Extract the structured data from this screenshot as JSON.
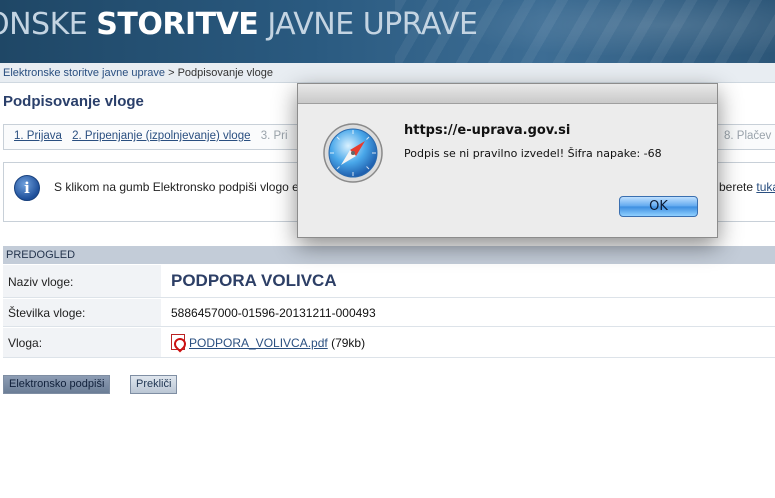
{
  "header": {
    "title_light_prefix": "ONSKE ",
    "title_bold": "STORITVE",
    "title_light_suffix": " JAVNE UPRAVE"
  },
  "breadcrumb": {
    "root": "Elektronske storitve javne uprave",
    "separator": " > ",
    "current": "Podpisovanje vloge"
  },
  "page_title": "Podpisovanje vloge",
  "steps": {
    "items": [
      "1. Prijava",
      "2. Pripenjanje (izpolnjevanje) vloge",
      "3. Pri"
    ],
    "right_item": "8. Plačev"
  },
  "info": {
    "text": "S klikom na gumb Elektronsko podpiši vlogo e",
    "text_right_prefix": "berete ",
    "text_right_link": "tuka"
  },
  "preview": {
    "section_title": "PREDOGLED",
    "rows": [
      {
        "label": "Naziv vloge:",
        "value": "PODPORA VOLIVCA"
      },
      {
        "label": "Številka vloge:",
        "value": "5886457000-01596-20131211-000493"
      },
      {
        "label": "Vloga:",
        "file_name": "PODPORA_VOLIVCA.pdf",
        "file_size": " (79kb)"
      }
    ]
  },
  "buttons": {
    "sign": "Elektronsko podpiši",
    "cancel": "Prekliči"
  },
  "dialog": {
    "host": "https://e-uprava.gov.si",
    "message": "Podpis se ni pravilno izvedel! Šifra napake:  -68",
    "ok_label": "OK"
  },
  "colors": {
    "banner": "#2a5a80",
    "link": "#2a4f80",
    "section_head": "#c3ccd8",
    "ok_button": "#5ea7ee"
  }
}
